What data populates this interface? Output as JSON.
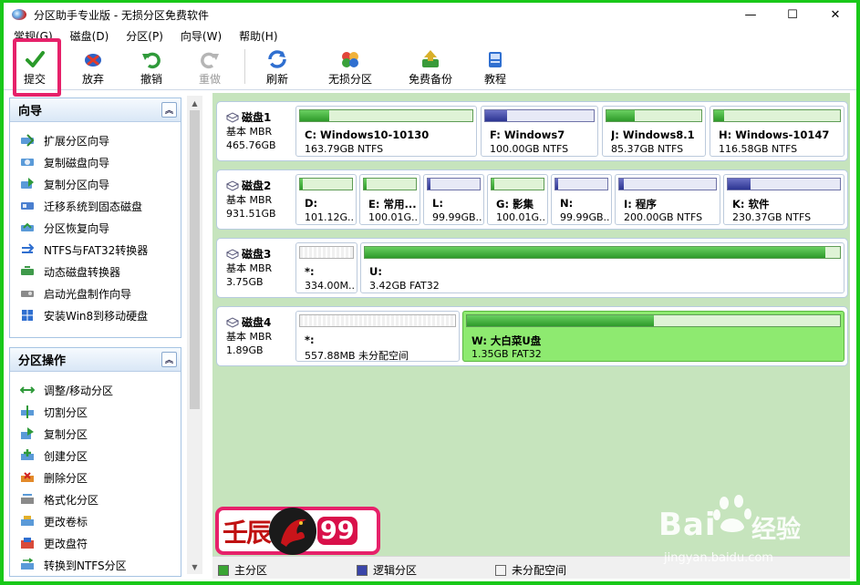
{
  "window": {
    "title": "分区助手专业版 - 无损分区免费软件",
    "min_glyph": "—",
    "max_glyph": "☐",
    "close_glyph": "✕"
  },
  "menu": [
    "常规(G)",
    "磁盘(D)",
    "分区(P)",
    "向导(W)",
    "帮助(H)"
  ],
  "toolbar": [
    {
      "label": "提交",
      "icon": "check-icon",
      "enabled": true
    },
    {
      "label": "放弃",
      "icon": "discard-icon",
      "enabled": true
    },
    {
      "label": "撤销",
      "icon": "undo-icon",
      "enabled": true
    },
    {
      "label": "重做",
      "icon": "redo-icon",
      "enabled": false
    },
    {
      "label": "刷新",
      "icon": "refresh-icon",
      "enabled": true
    },
    {
      "label": "无损分区",
      "icon": "partition-icon",
      "enabled": true
    },
    {
      "label": "免费备份",
      "icon": "backup-icon",
      "enabled": true
    },
    {
      "label": "教程",
      "icon": "tutorial-icon",
      "enabled": true
    }
  ],
  "wizard_panel": {
    "title": "向导",
    "items": [
      "扩展分区向导",
      "复制磁盘向导",
      "复制分区向导",
      "迁移系统到固态磁盘",
      "分区恢复向导",
      "NTFS与FAT32转换器",
      "动态磁盘转换器",
      "启动光盘制作向导",
      "安装Win8到移动硬盘"
    ]
  },
  "ops_panel": {
    "title": "分区操作",
    "items": [
      "调整/移动分区",
      "切割分区",
      "复制分区",
      "创建分区",
      "删除分区",
      "格式化分区",
      "更改卷标",
      "更改盘符",
      "转换到NTFS分区"
    ]
  },
  "disks": [
    {
      "name": "磁盘1",
      "type": "基本 MBR",
      "size": "465.76GB",
      "partitions": [
        {
          "label": "C: Windows10-10130",
          "desc": "163.79GB NTFS",
          "kind": "primary",
          "used": 0.17
        },
        {
          "label": "F: Windows7",
          "desc": "100.00GB NTFS",
          "kind": "logical",
          "used": 0.2
        },
        {
          "label": "J: Windows8.1",
          "desc": "85.37GB NTFS",
          "kind": "primary",
          "used": 0.3
        },
        {
          "label": "H: Windows-10147",
          "desc": "116.58GB NTFS",
          "kind": "primary",
          "used": 0.08
        }
      ]
    },
    {
      "name": "磁盘2",
      "type": "基本 MBR",
      "size": "931.51GB",
      "partitions": [
        {
          "label": "D:",
          "desc": "101.12G...",
          "kind": "primary",
          "used": 0.05
        },
        {
          "label": "E: 常用...",
          "desc": "100.01G...",
          "kind": "primary",
          "used": 0.05
        },
        {
          "label": "L:",
          "desc": "99.99GB...",
          "kind": "logical",
          "used": 0.05
        },
        {
          "label": "G: 影集",
          "desc": "100.01G...",
          "kind": "primary",
          "used": 0.05
        },
        {
          "label": "N:",
          "desc": "99.99GB...",
          "kind": "logical",
          "used": 0.05
        },
        {
          "label": "I: 程序",
          "desc": "200.00GB NTFS",
          "kind": "logical",
          "used": 0.05
        },
        {
          "label": "K: 软件",
          "desc": "230.37GB NTFS",
          "kind": "logical",
          "used": 0.2
        }
      ]
    },
    {
      "name": "磁盘3",
      "type": "基本 MBR",
      "size": "3.75GB",
      "partitions": [
        {
          "label": "*:",
          "desc": "334.00M...",
          "kind": "unalloc",
          "used": 0
        },
        {
          "label": "U:",
          "desc": "3.42GB FAT32",
          "kind": "primary",
          "used": 0.97
        }
      ]
    },
    {
      "name": "磁盘4",
      "type": "基本 MBR",
      "size": "1.89GB",
      "partitions": [
        {
          "label": "*:",
          "desc": "557.88MB 未分配空间",
          "kind": "unalloc",
          "used": 0
        },
        {
          "label": "W: 大白菜U盘",
          "desc": "1.35GB FAT32",
          "kind": "primary",
          "used": 0.5,
          "selected": true
        }
      ]
    }
  ],
  "legend": [
    {
      "label": "主分区",
      "color": "#3aa534"
    },
    {
      "label": "逻辑分区",
      "color": "#3a45a8"
    },
    {
      "label": "未分配空间",
      "color": "#f4f4f4"
    }
  ],
  "overlays": {
    "watermark_left": "壬辰",
    "watermark_num": "99",
    "baidu_word": "Bai",
    "baidu_cn": "经验",
    "baidu_url": "jingyan.baidu.com"
  }
}
